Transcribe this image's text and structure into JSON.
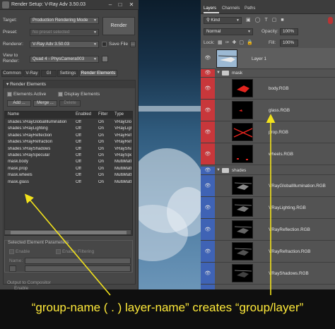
{
  "render_setup": {
    "title": "Render Setup: V-Ray Adv 3.50.03",
    "target_label": "Target:",
    "target_value": "Production Rendering Mode",
    "preset_label": "Preset:",
    "preset_value": "No preset selected",
    "renderer_label": "Renderer:",
    "renderer_value": "V-Ray Adv 3.50.03",
    "save_file_label": "Save File",
    "view_label_1": "View to",
    "view_label_2": "Render:",
    "view_value": "Quad 4 - PhysCamera003",
    "render_button": "Render",
    "tabs": [
      "Common",
      "V-Ray",
      "GI",
      "Settings",
      "Render Elements"
    ],
    "elements_header": "Render Elements",
    "elements_active": "Elements Active",
    "display_elements": "Display Elements",
    "add_button": "Add ...",
    "merge_button": "Merge ...",
    "delete_button": "Delete",
    "columns": [
      "Name",
      "Enabled",
      "Filter",
      "Type"
    ],
    "rows": [
      {
        "name": "shades.VRayGlobalIllumination",
        "enabled": "Off",
        "filter": "On",
        "type": "VRayGlob"
      },
      {
        "name": "shades.VRayLighting",
        "enabled": "Off",
        "filter": "On",
        "type": "VRayLight"
      },
      {
        "name": "shades.VRayReflection",
        "enabled": "Off",
        "filter": "On",
        "type": "VRayRefle"
      },
      {
        "name": "shades.VRayRefraction",
        "enabled": "Off",
        "filter": "On",
        "type": "VRayRefra"
      },
      {
        "name": "shades.VRayShadows",
        "enabled": "Off",
        "filter": "On",
        "type": "VRayShad"
      },
      {
        "name": "shades.VRaySpecular",
        "enabled": "Off",
        "filter": "On",
        "type": "VRaySpec"
      },
      {
        "name": "mask.body",
        "enabled": "Off",
        "filter": "On",
        "type": "MultiMatte"
      },
      {
        "name": "mask.prop",
        "enabled": "Off",
        "filter": "On",
        "type": "MultiMatte"
      },
      {
        "name": "mask.wheels",
        "enabled": "Off",
        "filter": "On",
        "type": "MultiMatte"
      },
      {
        "name": "mask.glass",
        "enabled": "Off",
        "filter": "On",
        "type": "MultiMatte"
      }
    ],
    "selected_params": "Selected Element Parameters",
    "enable_label": "Enable",
    "enable_filtering_label": "Enable Filtering",
    "name_label": "Name:",
    "output_label": "Output to Compositor",
    "enable_label_2": "Enable"
  },
  "layers_panel": {
    "tabs": [
      "Layers",
      "Channels",
      "Paths"
    ],
    "kind_label": "Kind",
    "blend_mode": "Normal",
    "opacity_label": "Opacity:",
    "opacity_value": "100%",
    "lock_label": "Lock:",
    "fill_label": "Fill:",
    "fill_value": "100%",
    "layer1": "Layer 1",
    "mask_group": "mask",
    "mask_layers": [
      "body.RGB",
      "glass.RGB",
      "prop.RGB",
      "wheels.RGB"
    ],
    "shades_group": "shades",
    "shades_layers": [
      "VRayGlobalIllumination.RGB",
      "VRayLighting.RGB",
      "VRayReflection.RGB",
      "VRayRefraction.RGB",
      "VRayShadows.RGB"
    ],
    "colors": {
      "mask_tag": "#c8373b",
      "shades_tag": "#3f63b5"
    }
  },
  "caption": "“group-name ( . ) layer-name”  creates  “group/layer”",
  "colors": {
    "caption": "#ffea3a",
    "arrow": "#f2e21c"
  }
}
